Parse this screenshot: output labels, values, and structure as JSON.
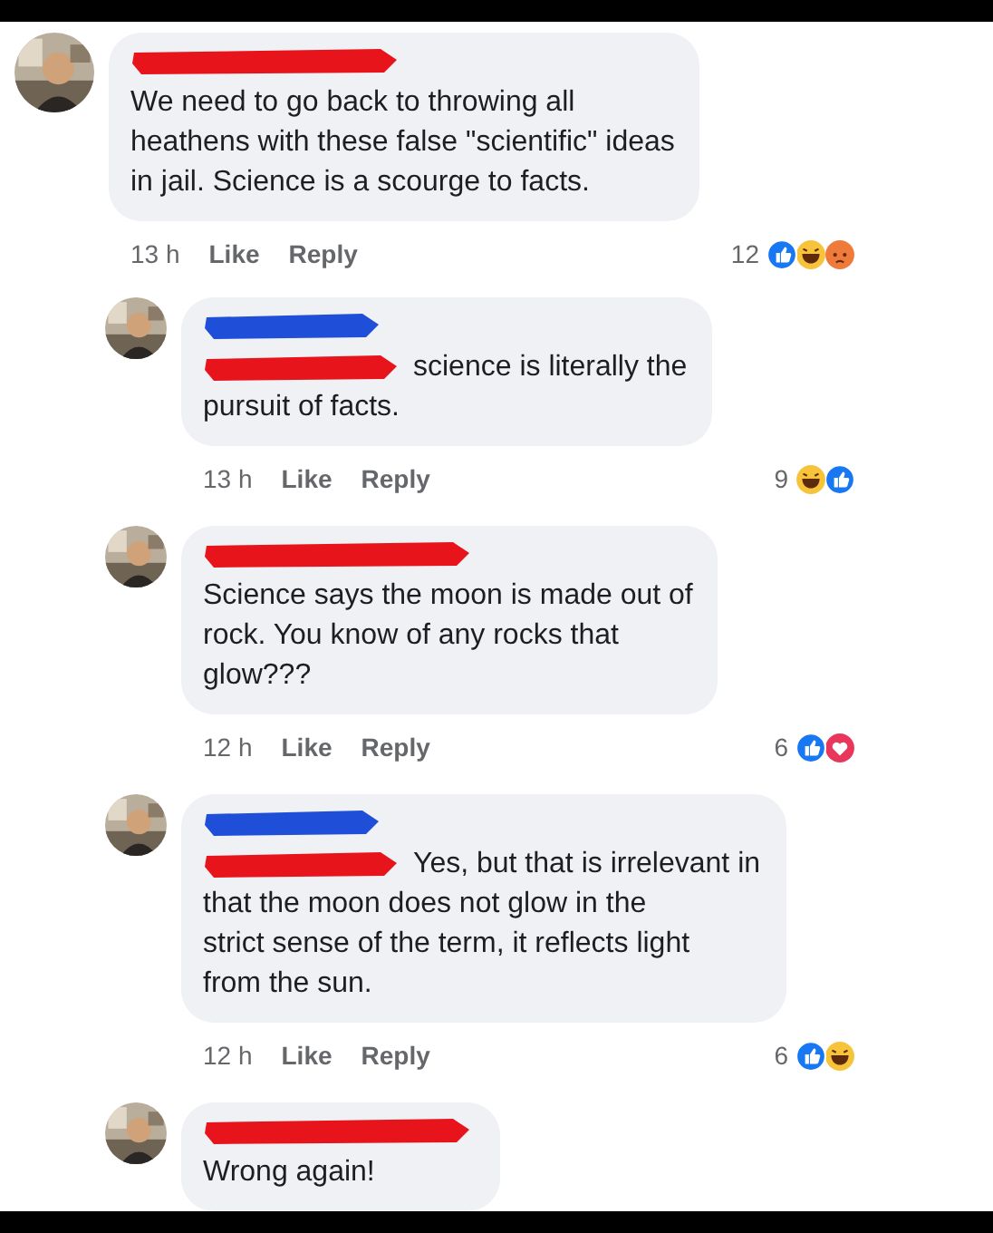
{
  "comments": [
    {
      "reply": false,
      "name_marks": [
        {
          "color": "#e8141b"
        }
      ],
      "text": "We need to go back to throwing all\nheathens with these false \"scientific\" ideas\nin jail. Science is a scourge to facts.",
      "time": "13 h",
      "like": "Like",
      "reply_label": "Reply",
      "count": "12",
      "reactions": [
        {
          "kind": "like"
        },
        {
          "kind": "haha"
        },
        {
          "kind": "angry"
        }
      ]
    },
    {
      "reply": true,
      "name_marks": [
        {
          "color": "#1f4fd8"
        },
        {
          "color": "#e8141b"
        }
      ],
      "text": "science is literally the\npursuit of facts.",
      "time": "13 h",
      "like": "Like",
      "reply_label": "Reply",
      "count": "9",
      "reactions": [
        {
          "kind": "haha"
        },
        {
          "kind": "like"
        }
      ]
    },
    {
      "reply": true,
      "name_marks": [
        {
          "color": "#e8141b"
        }
      ],
      "text": "Science says the moon is made out of\nrock. You know of any rocks that\nglow???",
      "time": "12 h",
      "like": "Like",
      "reply_label": "Reply",
      "count": "6",
      "reactions": [
        {
          "kind": "like"
        },
        {
          "kind": "love"
        }
      ]
    },
    {
      "reply": true,
      "name_marks": [
        {
          "color": "#1f4fd8"
        },
        {
          "color": "#e8141b"
        }
      ],
      "text": "Yes, but that is irrelevant in\nthat the moon does not glow in the\nstrict sense of the term, it reflects light\nfrom the sun.",
      "time": "12 h",
      "like": "Like",
      "reply_label": "Reply",
      "count": "6",
      "reactions": [
        {
          "kind": "like"
        },
        {
          "kind": "haha"
        }
      ]
    },
    {
      "reply": true,
      "name_marks": [
        {
          "color": "#e8141b"
        }
      ],
      "text": "Wrong again!"
    }
  ]
}
